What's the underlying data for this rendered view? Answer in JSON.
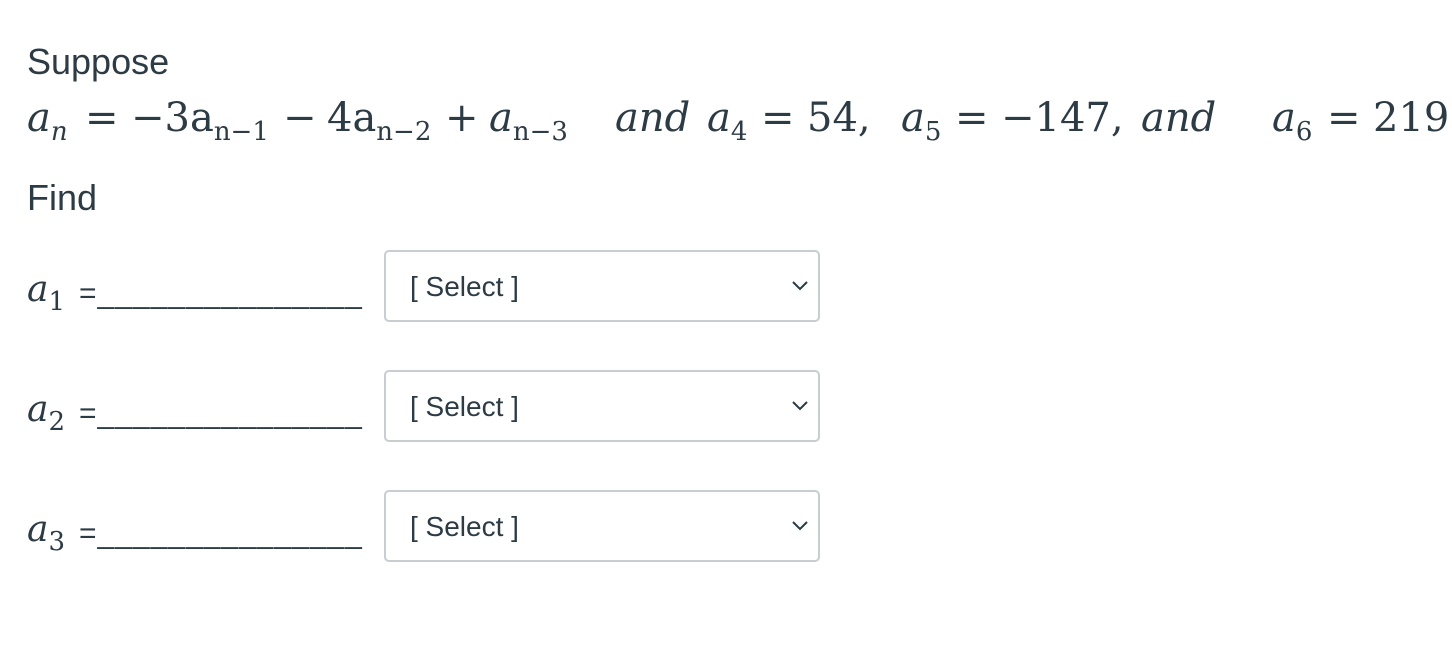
{
  "question": {
    "intro_text": "Suppose",
    "find_text": "Find",
    "equation": {
      "lhs": "a",
      "lhs_sub": "n",
      "eq1": "=",
      "t1": "−3a",
      "t1_sub": "n−1",
      "op1": "−",
      "t2": "4a",
      "t2_sub": "n−2",
      "op2": "+",
      "t3": "a",
      "t3_sub": "n−3",
      "and1": "and",
      "c1": "a",
      "c1_sub": "4",
      "c1_eq": "=",
      "c1_val": "54,",
      "c2": "a",
      "c2_sub": "5",
      "c2_eq": "=",
      "c2_val": "−147,",
      "and2": "and",
      "c3": "a",
      "c3_sub": "6",
      "c3_eq": "=",
      "c3_val": "219"
    }
  },
  "answers": [
    {
      "var": "a",
      "sub": "1",
      "blank": "=_______________",
      "selected": "[ Select ]"
    },
    {
      "var": "a",
      "sub": "2",
      "blank": "=_______________",
      "selected": "[ Select ]"
    },
    {
      "var": "a",
      "sub": "3",
      "blank": "=_______________",
      "selected": "[ Select ]"
    }
  ],
  "icons": {
    "dropdown": "chevron-down-icon"
  }
}
